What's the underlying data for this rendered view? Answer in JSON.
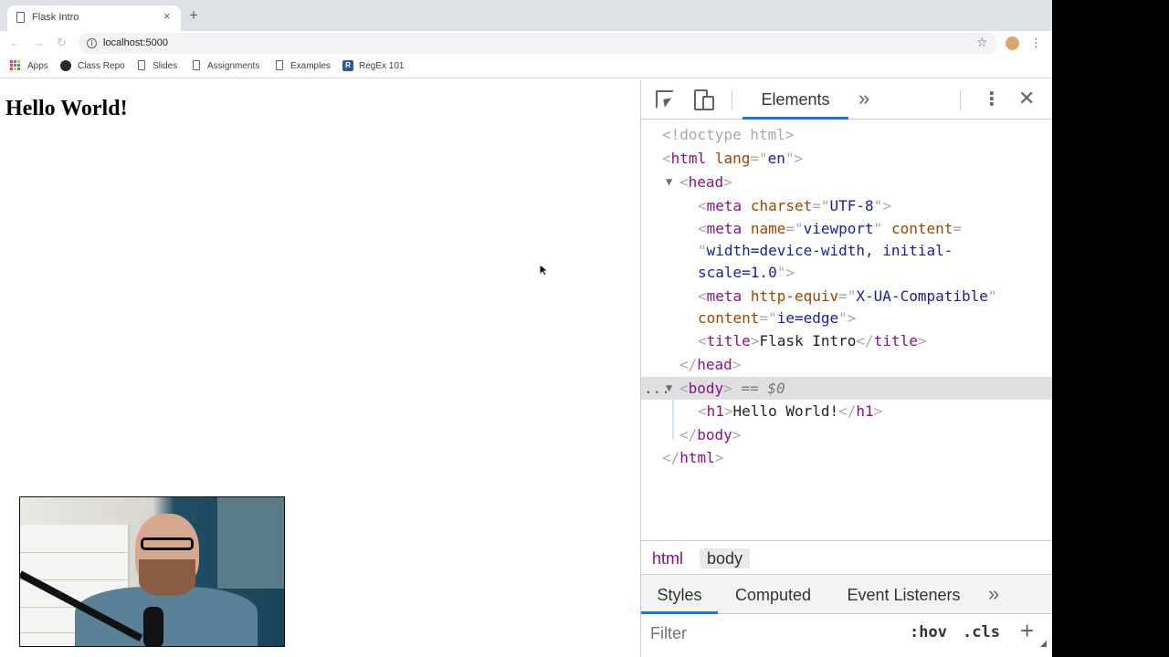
{
  "browser": {
    "tab_title": "Flask Intro",
    "tab_close": "×",
    "new_tab": "+",
    "url": "localhost:5000",
    "bookmarks": [
      "Apps",
      "Class Repo",
      "Slides",
      "Assignments",
      "Examples",
      "RegEx 101"
    ]
  },
  "page": {
    "heading": "Hello World!"
  },
  "devtools": {
    "active_tab": "Elements",
    "more_tabs": "»",
    "close": "✕",
    "menu": "⋮",
    "dom": {
      "doctype": "<!doctype html>",
      "html_open_tag": "html",
      "html_lang_attr": "lang",
      "html_lang_val": "en",
      "head_tag": "head",
      "meta": "meta",
      "charset_attr": "charset",
      "charset_val": "UTF-8",
      "name_attr": "name",
      "name_val": "viewport",
      "content_attr": "content",
      "viewport_content_line1": "width=device-width, initial-",
      "viewport_content_line2": "scale=1.0",
      "http_equiv_attr": "http-equiv",
      "http_equiv_val": "X-UA-Compatible",
      "ie_content_val": "ie=edge",
      "title_tag": "title",
      "title_text": "Flask Intro",
      "body_tag": "body",
      "selected_marker": "== $0",
      "ellipsis": "...",
      "h1_tag": "h1",
      "h1_text": "Hello World!"
    },
    "breadcrumb": [
      "html",
      "body"
    ],
    "styles_tabs": [
      "Styles",
      "Computed",
      "Event Listeners"
    ],
    "filter_placeholder": "Filter",
    "hov": ":hov",
    "cls": ".cls",
    "add": "+"
  },
  "colors": {
    "tag": "#881280",
    "attr_name": "#994500",
    "attr_value": "#1a1aa6",
    "accent": "#1a73e8",
    "selected_row": "#e0e0e0"
  },
  "icons": [
    "page-icon",
    "close-icon",
    "plus-icon",
    "back-icon",
    "forward-icon",
    "reload-icon",
    "info-icon",
    "star-icon",
    "profile-icon",
    "kebab-icon",
    "apps-icon",
    "github-icon",
    "regex-icon",
    "inspect-icon",
    "device-toolbar-icon",
    "chevron-double-right-icon",
    "mouse-cursor-icon"
  ]
}
